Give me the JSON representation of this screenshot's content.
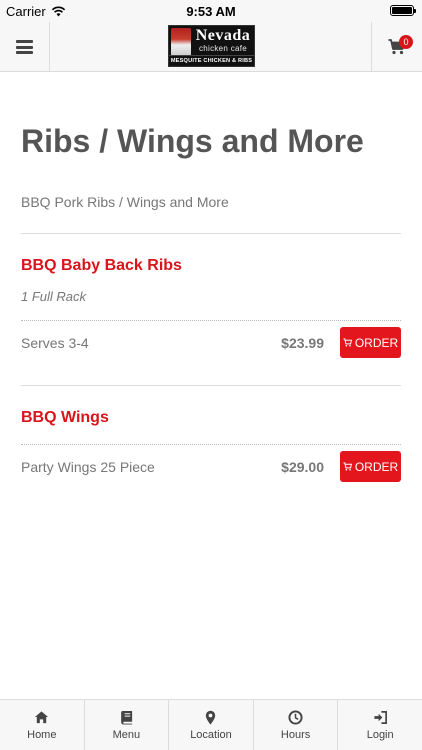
{
  "status_bar": {
    "carrier": "Carrier",
    "time": "9:53 AM"
  },
  "header": {
    "logo": {
      "name": "Nevada",
      "tagline": "chicken cafe",
      "subline": "MESQUITE CHICKEN & RIBS"
    },
    "cart_count": "0"
  },
  "page": {
    "title": "Ribs / Wings and More",
    "subtitle": "BBQ Pork Ribs / Wings and More"
  },
  "items": [
    {
      "name": "BBQ Baby Back Ribs",
      "description": "1 Full Rack",
      "options": [
        {
          "label": "Serves 3-4",
          "price": "$23.99",
          "button": "ORDER"
        }
      ]
    },
    {
      "name": "BBQ Wings",
      "description": "",
      "options": [
        {
          "label": "Party Wings 25 Piece",
          "price": "$29.00",
          "button": "ORDER"
        }
      ]
    }
  ],
  "bottom_nav": [
    {
      "label": "Home",
      "icon": "home-icon"
    },
    {
      "label": "Menu",
      "icon": "book-icon"
    },
    {
      "label": "Location",
      "icon": "map-pin-icon"
    },
    {
      "label": "Hours",
      "icon": "clock-icon"
    },
    {
      "label": "Login",
      "icon": "sign-in-icon"
    }
  ],
  "colors": {
    "accent": "#e3151d",
    "item_title": "#d9141b",
    "text": "#555555",
    "muted": "#777777",
    "bar_bg": "#f7f7f7"
  }
}
